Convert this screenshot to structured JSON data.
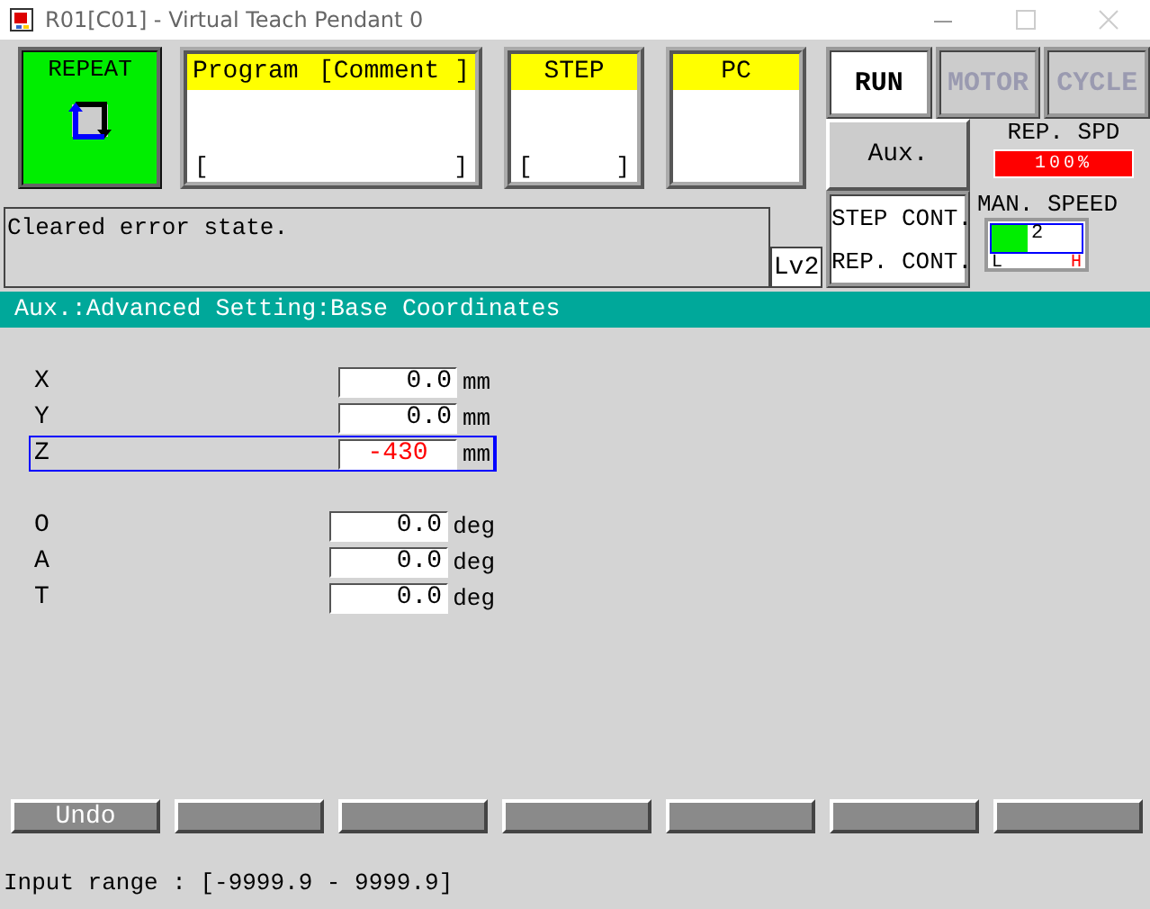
{
  "window": {
    "title": "R01[C01] - Virtual Teach Pendant 0"
  },
  "mode": {
    "label": "REPEAT"
  },
  "program_panel": {
    "title": "Program",
    "comment": "[Comment ]",
    "open_bracket": "[",
    "close_bracket": "]"
  },
  "step_panel": {
    "title": "STEP",
    "open_bracket": "[",
    "close_bracket": "]"
  },
  "pc_panel": {
    "title": "PC"
  },
  "status_buttons": [
    {
      "label": "RUN",
      "disabled": false
    },
    {
      "label": "MOTOR",
      "disabled": true
    },
    {
      "label": "CYCLE",
      "disabled": true
    }
  ],
  "aux_button": {
    "label": "Aux."
  },
  "rep_speed": {
    "label": "REP. SPD",
    "reading": "100%",
    "level": 1.0
  },
  "message": {
    "text": "Cleared error state."
  },
  "level_badge": "Lv2",
  "continuity": {
    "step": "STEP CONT.",
    "rep": "REP. CONT."
  },
  "man_speed": {
    "label": "MAN. SPEED",
    "reading": "2",
    "level": 0.4,
    "low": "L",
    "high": "H"
  },
  "breadcrumb": "Aux.:Advanced Setting:Base Coordinates",
  "field_groups": [
    [
      {
        "label": "X",
        "value": "0.0",
        "unit": "mm",
        "selected": false
      },
      {
        "label": "Y",
        "value": "0.0",
        "unit": "mm",
        "selected": false
      },
      {
        "label": "Z",
        "value": "-430",
        "unit": "mm",
        "selected": true
      }
    ],
    [
      {
        "label": "O",
        "value": "0.0",
        "unit": "deg",
        "selected": false
      },
      {
        "label": "A",
        "value": "0.0",
        "unit": "deg",
        "selected": false
      },
      {
        "label": "T",
        "value": "0.0",
        "unit": "deg",
        "selected": false
      }
    ]
  ],
  "function_keys": [
    {
      "kind": "labeled",
      "label": "Undo"
    },
    {
      "kind": "blank"
    },
    {
      "kind": "blank"
    },
    {
      "kind": "blank"
    },
    {
      "kind": "blank"
    },
    {
      "kind": "blank"
    },
    {
      "kind": "blank"
    }
  ],
  "status_bar": "Input range : [-9999.9 - 9999.9]"
}
